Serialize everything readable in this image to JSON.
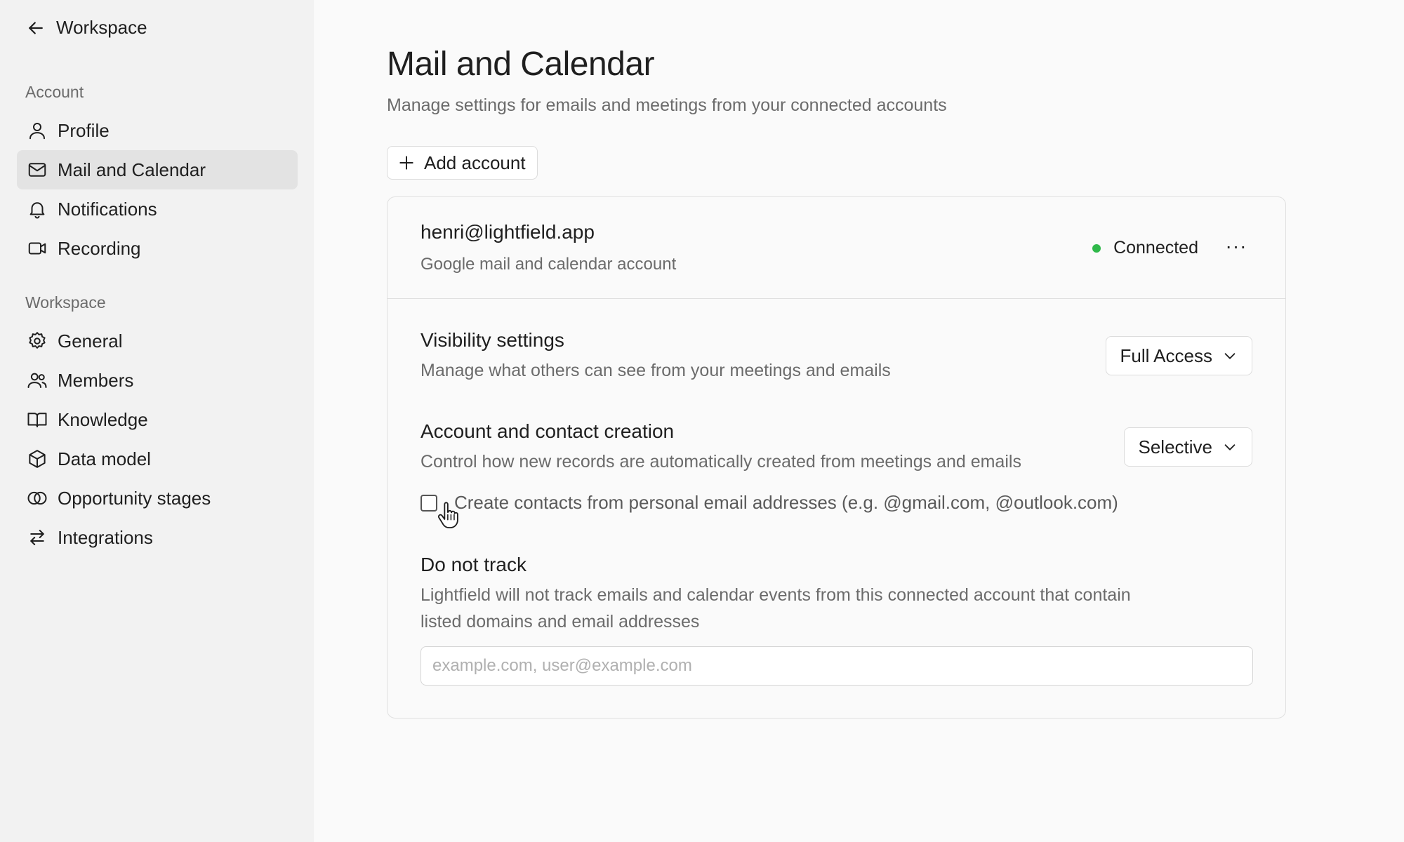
{
  "sidebar": {
    "back_label": "Workspace",
    "account_section": "Account",
    "workspace_section": "Workspace",
    "account_items": [
      {
        "label": "Profile",
        "icon": "user-icon"
      },
      {
        "label": "Mail and Calendar",
        "icon": "mail-icon",
        "active": true
      },
      {
        "label": "Notifications",
        "icon": "bell-icon"
      },
      {
        "label": "Recording",
        "icon": "video-icon"
      }
    ],
    "workspace_items": [
      {
        "label": "General",
        "icon": "gear-icon"
      },
      {
        "label": "Members",
        "icon": "users-icon"
      },
      {
        "label": "Knowledge",
        "icon": "book-icon"
      },
      {
        "label": "Data model",
        "icon": "cube-icon"
      },
      {
        "label": "Opportunity stages",
        "icon": "circles-icon"
      },
      {
        "label": "Integrations",
        "icon": "arrows-icon"
      }
    ]
  },
  "main": {
    "title": "Mail and Calendar",
    "subtitle": "Manage settings for emails and meetings from your connected accounts",
    "add_account_label": "Add account"
  },
  "account": {
    "email": "henri@lightfield.app",
    "type": "Google mail and calendar account",
    "status": "Connected",
    "status_color": "#2fb84a",
    "more_label": "···"
  },
  "settings": {
    "visibility": {
      "title": "Visibility settings",
      "description": "Manage what others can see from your meetings and emails",
      "value": "Full Access"
    },
    "creation": {
      "title": "Account and contact creation",
      "description": "Control how new records are automatically created from meetings and emails",
      "value": "Selective",
      "checkbox_label": "Create contacts from personal email addresses (e.g. @gmail.com, @outlook.com)",
      "checkbox_checked": false
    },
    "do_not_track": {
      "title": "Do not track",
      "description_line1": "Lightfield will not track emails and calendar events from this connected account that contain",
      "description_line2": "listed domains and email addresses",
      "placeholder": "example.com, user@example.com",
      "value": ""
    }
  }
}
